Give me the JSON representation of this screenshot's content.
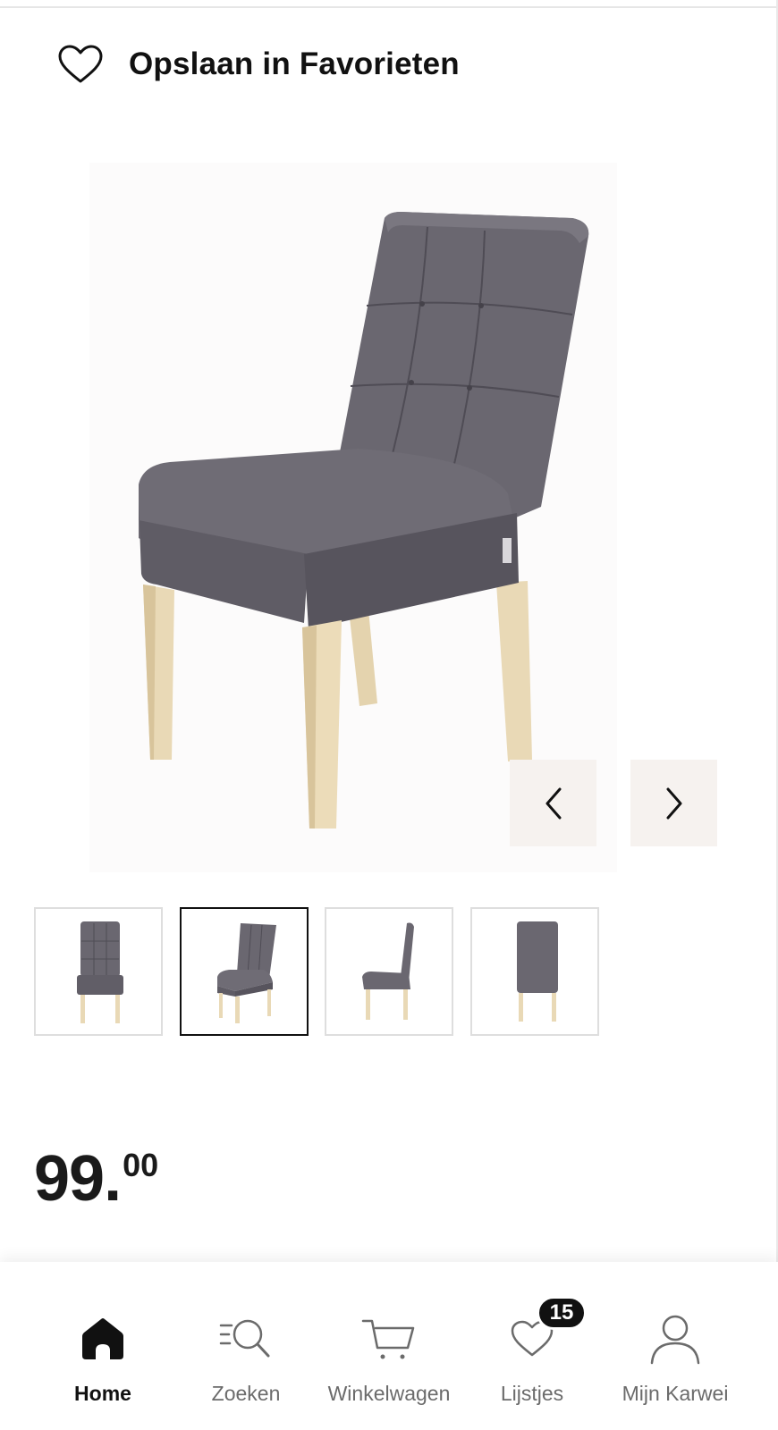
{
  "favorites": {
    "label": "Opslaan in Favorieten",
    "icon": "heart-outline-icon"
  },
  "gallery": {
    "main_image_alt": "grey upholstered dining chair with wooden legs",
    "prev_icon": "chevron-left-icon",
    "next_icon": "chevron-right-icon",
    "selected_index": 2,
    "thumbnails": [
      {
        "view": "front"
      },
      {
        "view": "three-quarter"
      },
      {
        "view": "side"
      },
      {
        "view": "back"
      }
    ],
    "colors": {
      "fabric": "#6a6770",
      "fabric_shade": "#57545d",
      "wood": "#e9d9b6",
      "nav_bg": "#f6f2ef"
    }
  },
  "price": {
    "integer": "99.",
    "decimals": "00"
  },
  "bottom_nav": {
    "items": [
      {
        "label": "Home",
        "icon": "home-icon",
        "active": true
      },
      {
        "label": "Zoeken",
        "icon": "search-icon",
        "active": false
      },
      {
        "label": "Winkelwagen",
        "icon": "cart-icon",
        "active": false
      },
      {
        "label": "Lijstjes",
        "icon": "heart-list-icon",
        "active": false
      },
      {
        "label": "Mijn Karwei",
        "icon": "user-icon",
        "active": false
      }
    ],
    "lists_badge": "15"
  }
}
